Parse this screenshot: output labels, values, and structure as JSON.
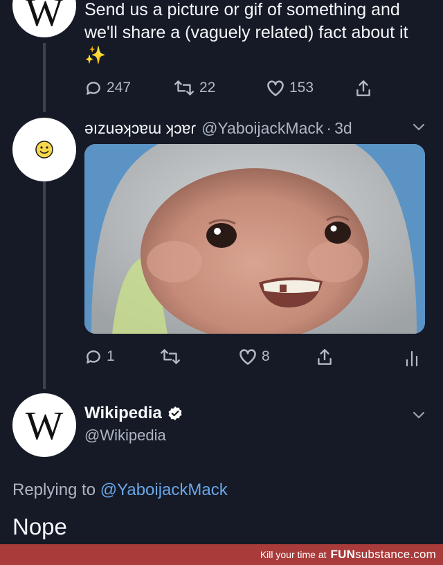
{
  "tweet1": {
    "text": "Send us a picture or gif of something and we'll share a (vaguely related) fact about it ✨",
    "avatar_letter": "W",
    "actions": {
      "replies": "247",
      "retweets": "22",
      "likes": "153"
    }
  },
  "tweet2": {
    "display_name": "ǝızuǝʞɔɐɯ ʞɔɐɾ",
    "handle": "@YaboijackMack",
    "separator": "·",
    "time": "3d",
    "avatar_icon": "smiley-face",
    "actions": {
      "replies": "1",
      "likes": "8"
    },
    "colors": {
      "image_bg": "#5b93c4"
    }
  },
  "reply": {
    "display_name": "Wikipedia",
    "handle": "@Wikipedia",
    "avatar_letter": "W",
    "replying_prefix": "Replying to",
    "replying_handle": "@YaboijackMack",
    "text": "Nope",
    "colors": {
      "link": "#6aa6e8",
      "verified": "#ffffff"
    }
  },
  "footer": {
    "tagline": "Kill your time at",
    "brand_bold": "FUN",
    "brand_rest": "substance.com",
    "color": "#a93b3b"
  }
}
